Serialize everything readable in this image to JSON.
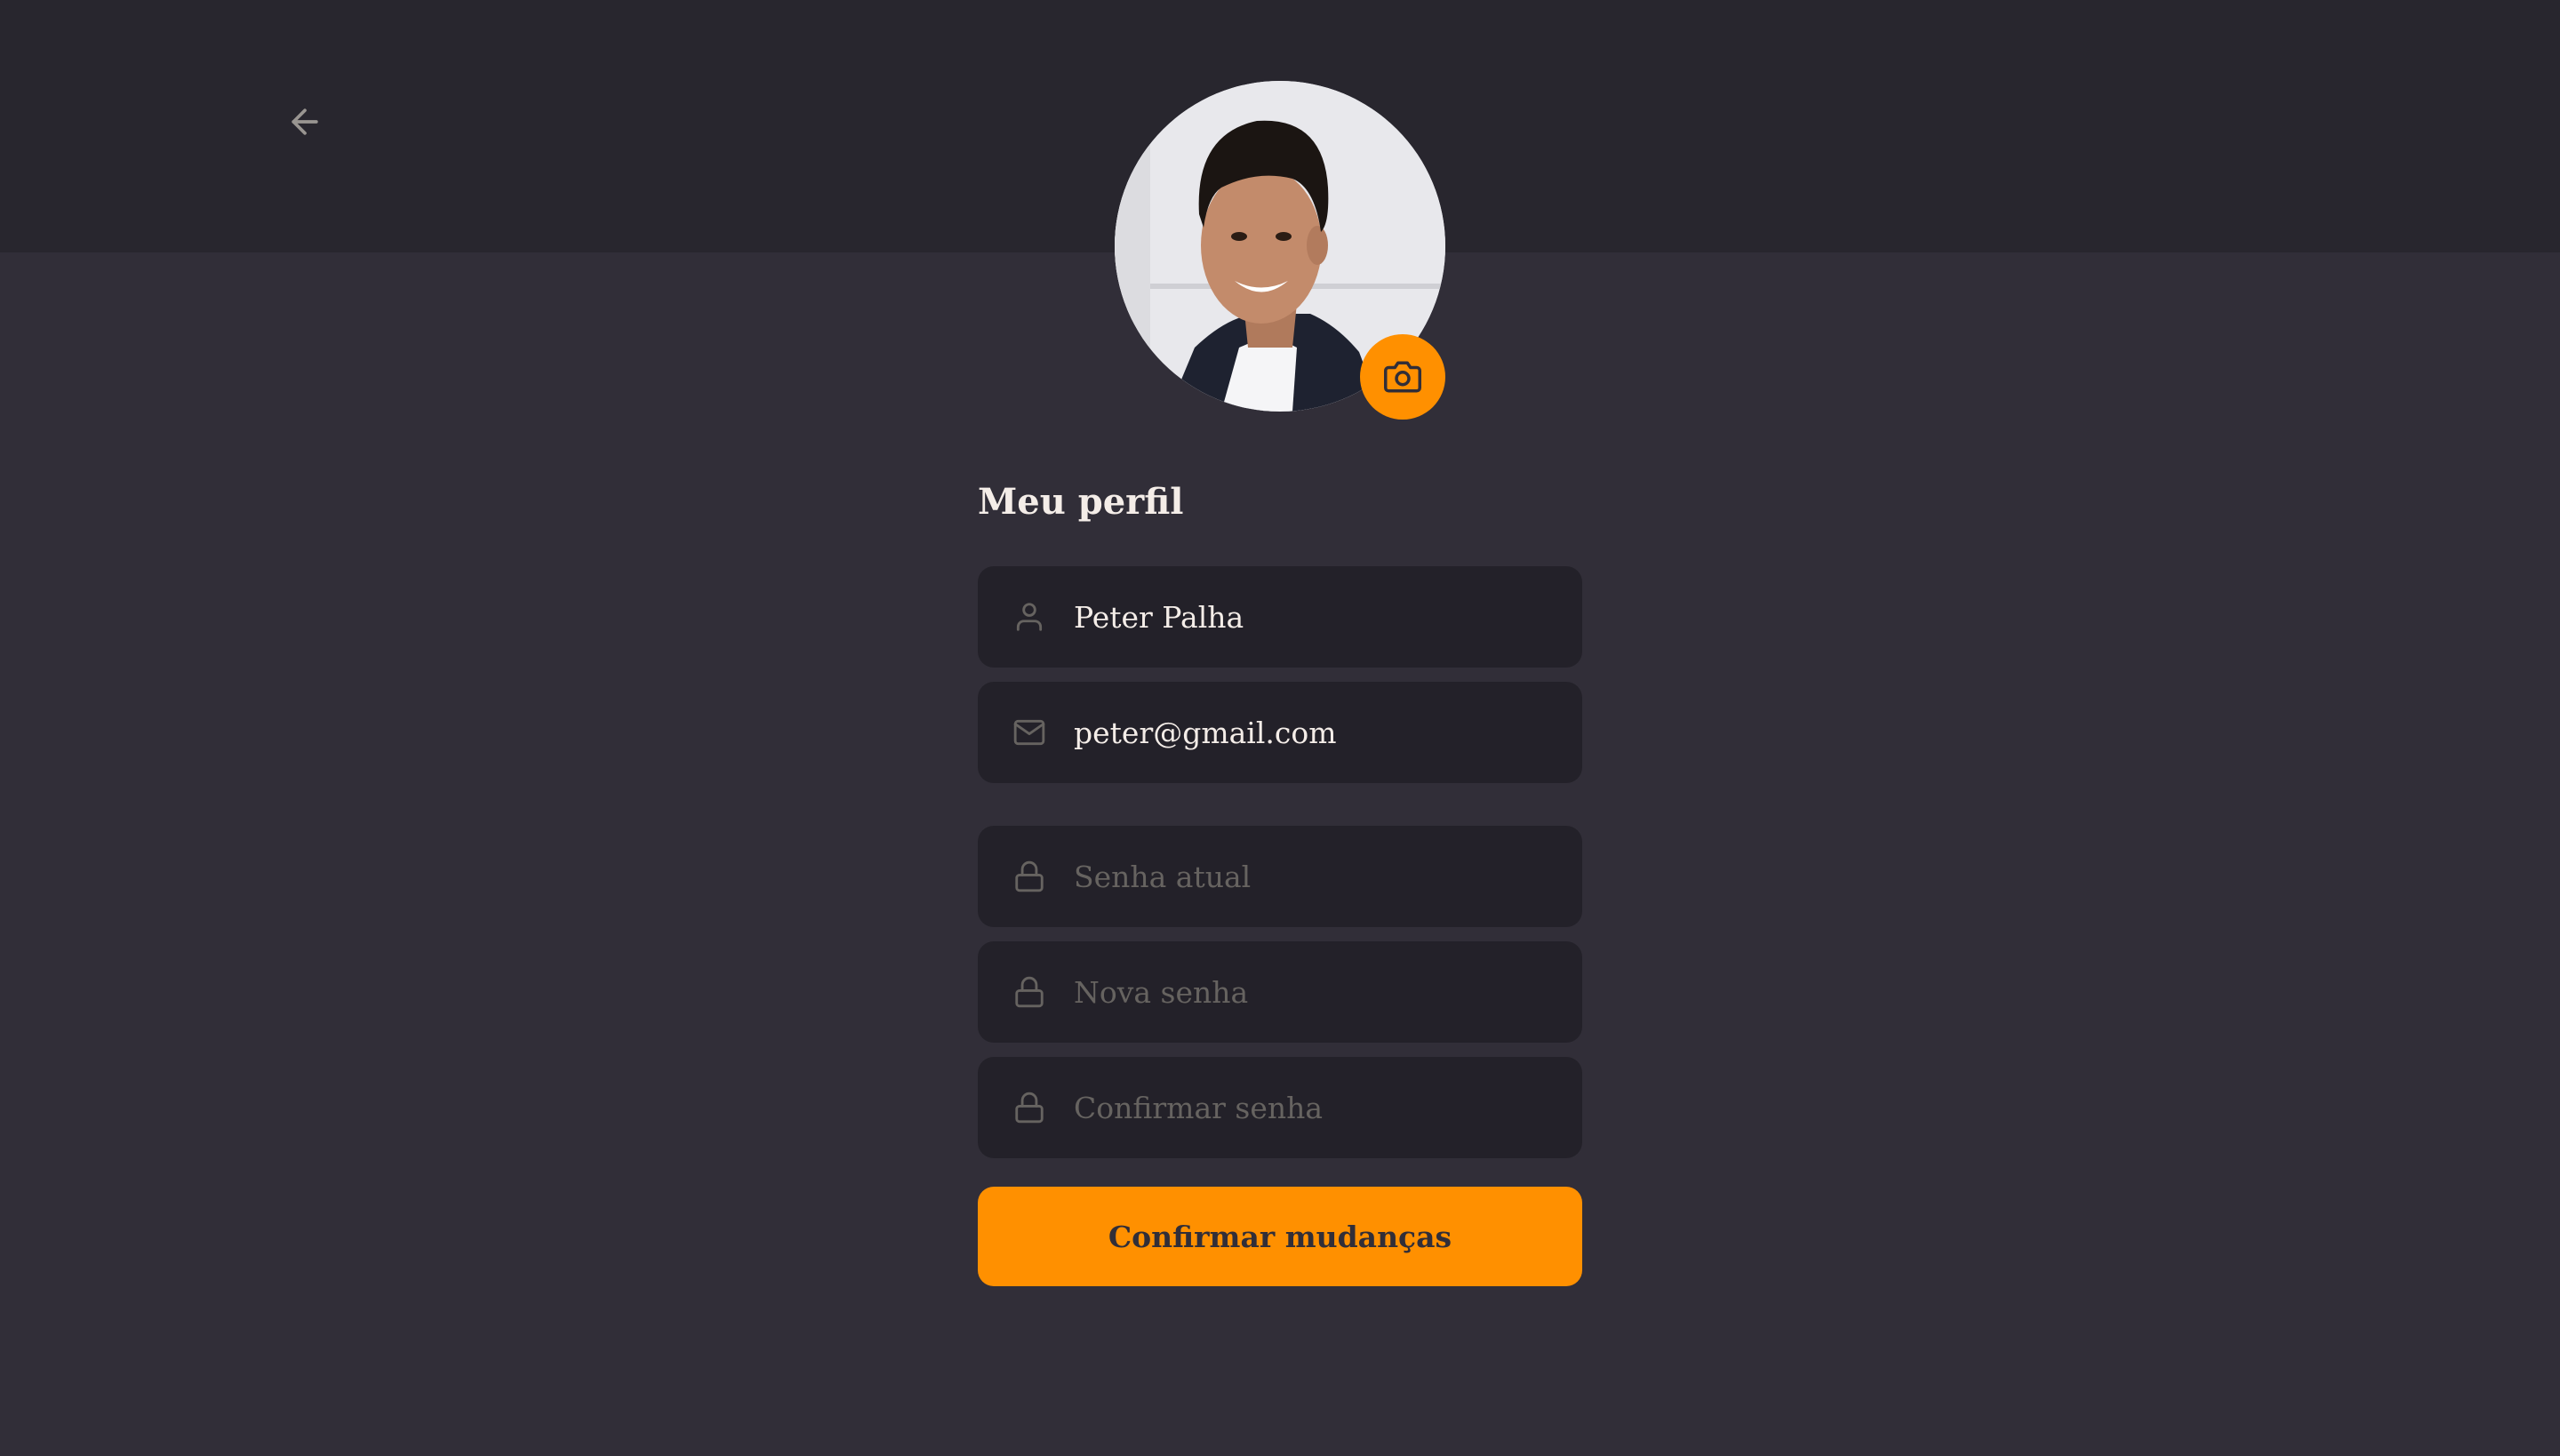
{
  "colors": {
    "background": "#312e38",
    "header": "#28262e",
    "field_background": "#232129",
    "accent": "#ff9000",
    "text": "#f4ede8",
    "placeholder": "#666360"
  },
  "header": {
    "back_icon": "arrow-left-icon"
  },
  "profile": {
    "avatar_alt": "avatar",
    "camera_icon": "camera-icon"
  },
  "form": {
    "title": "Meu perfil",
    "name": {
      "icon": "user-icon",
      "value": "Peter Palha"
    },
    "email": {
      "icon": "mail-icon",
      "value": "peter@gmail.com"
    },
    "old_password": {
      "icon": "lock-icon",
      "placeholder": "Senha atual"
    },
    "new_password": {
      "icon": "lock-icon",
      "placeholder": "Nova senha"
    },
    "confirm_password": {
      "icon": "lock-icon",
      "placeholder": "Confirmar senha"
    },
    "submit_label": "Confirmar mudanças"
  }
}
